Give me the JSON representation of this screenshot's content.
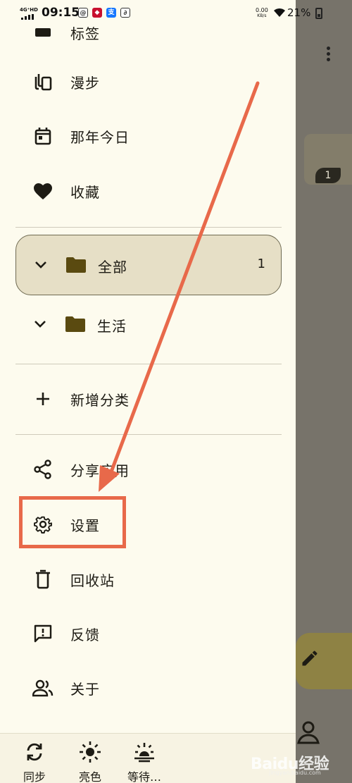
{
  "status_bar": {
    "network": "4G⁺HD",
    "time": "09:15",
    "speed_value": "0.00",
    "speed_unit": "KB/s",
    "battery": "21%"
  },
  "drawer": {
    "partial_item": "标签",
    "top_items": [
      {
        "label": "漫步",
        "icon": "stack-icon"
      },
      {
        "label": "那年今日",
        "icon": "calendar-icon"
      },
      {
        "label": "收藏",
        "icon": "heart-icon"
      }
    ],
    "folders": [
      {
        "label": "全部",
        "count": "1",
        "selected": true
      },
      {
        "label": "生活",
        "count": "",
        "selected": false
      }
    ],
    "add_category": "新增分类",
    "bottom_items": [
      {
        "label": "分享应用",
        "icon": "share-icon"
      },
      {
        "label": "设置",
        "icon": "gear-icon"
      },
      {
        "label": "回收站",
        "icon": "trash-icon"
      },
      {
        "label": "反馈",
        "icon": "feedback-icon"
      },
      {
        "label": "关于",
        "icon": "people-icon"
      }
    ]
  },
  "bottom_bar": {
    "buttons": [
      {
        "label": "同步",
        "icon": "sync-icon"
      },
      {
        "label": "亮色",
        "icon": "sun-icon"
      },
      {
        "label": "等待…",
        "icon": "sunrise-icon"
      }
    ]
  },
  "background": {
    "badge_count": "1"
  },
  "watermark": {
    "text": "Baidu经验",
    "sub": "jingyan.baidu.com"
  },
  "colors": {
    "drawer_bg": "#fdfbee",
    "selected_bg": "#e6dfc6",
    "folder": "#5a4a10",
    "annotation": "#e8694a",
    "scrim": "#77736a"
  }
}
